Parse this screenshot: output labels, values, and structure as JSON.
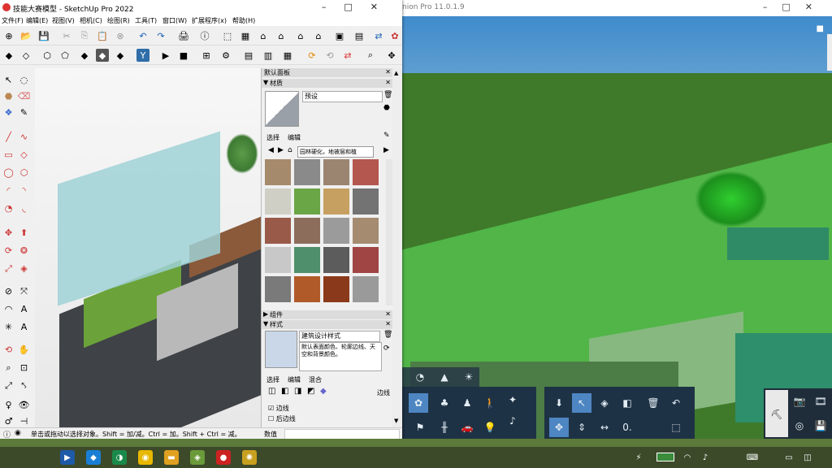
{
  "lumion": {
    "title": "nion Pro 11.0.1.9",
    "window_controls": [
      "–",
      "□",
      "✕"
    ],
    "minimize_glyph": "■"
  },
  "sketchup": {
    "title": "技能大赛模型 - SketchUp Pro 2022",
    "window_controls": [
      "–",
      "□",
      "✕"
    ],
    "menu": [
      "文件(F)",
      "编辑(E)",
      "视图(V)",
      "相机(C)",
      "绘图(R)",
      "工具(T)",
      "窗口(W)",
      "扩展程序(x)",
      "帮助(H)"
    ],
    "tray": {
      "header": "默认面板",
      "materials_header": "材质",
      "material_name": "预设",
      "tabs": [
        "选择",
        "编辑"
      ],
      "collection": "园林硬化，地被层和植",
      "components_header": "组件",
      "styles_header": "样式",
      "style_name": "建筑设计样式",
      "style_desc": "默认表面颜色、轮廓边线、天空和背景颜色。",
      "style_tabs": [
        "选择",
        "编辑",
        "混合"
      ],
      "edges_label": "边线",
      "checkbox_edges": "边线",
      "checkbox_back_edges": "后边线"
    },
    "status_hint": "单击或拖动以选择对象。Shift = 加/减。Ctrl = 加。Shift + Ctrl = 减。",
    "status_value_label": "数值"
  },
  "colors": {
    "lumion_selected": "#4d86c2",
    "lumion_panel": "#1e3245"
  }
}
